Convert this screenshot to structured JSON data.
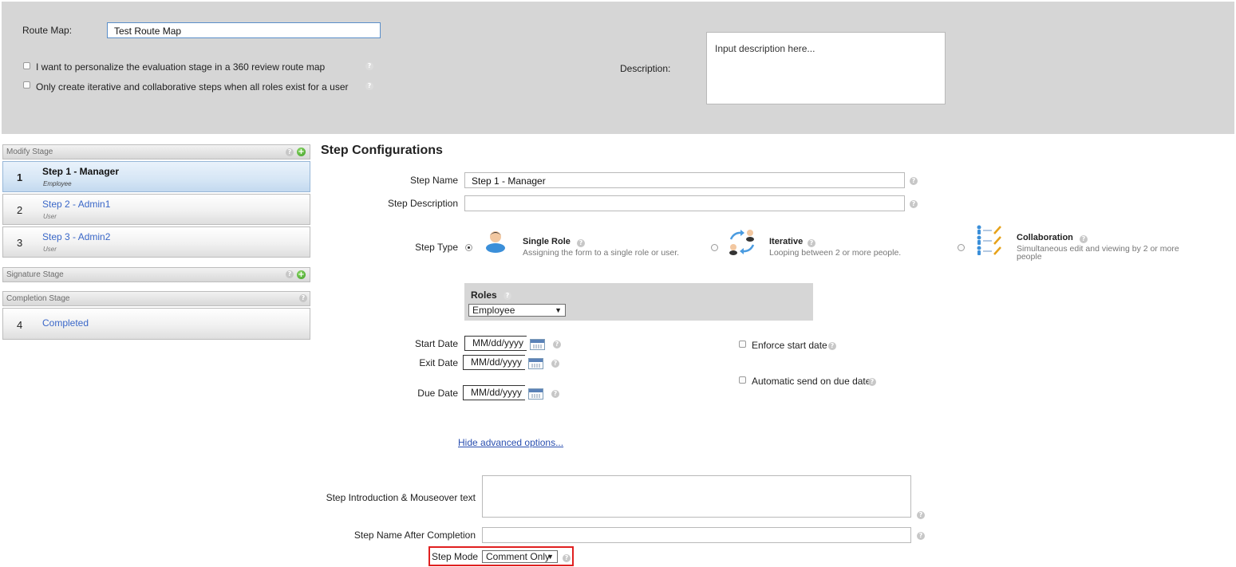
{
  "header": {
    "route_map_label": "Route Map:",
    "route_map_value": "Test Route Map",
    "personalize_label": "I want to personalize the evaluation stage in a 360 review route map",
    "iterative_label": "Only create iterative and collaborative steps when all roles exist for a user",
    "description_label": "Description:",
    "description_placeholder": "Input description here..."
  },
  "stages": {
    "modify_stage": "Modify Stage",
    "signature_stage": "Signature Stage",
    "completion_stage": "Completion Stage",
    "steps": [
      {
        "num": "1",
        "name": "Step 1 - Manager",
        "role": "Employee"
      },
      {
        "num": "2",
        "name": "Step 2 - Admin1",
        "role": "User"
      },
      {
        "num": "3",
        "name": "Step 3 - Admin2",
        "role": "User"
      }
    ],
    "completed": {
      "num": "4",
      "name": "Completed"
    }
  },
  "config": {
    "title": "Step Configurations",
    "step_name_label": "Step Name",
    "step_name_value": "Step 1 - Manager",
    "step_description_label": "Step Description",
    "step_description_value": "",
    "step_type_label": "Step Type",
    "types": [
      {
        "title": "Single Role",
        "desc": "Assigning the form to a single role or user.",
        "icon": "single-role-person-icon"
      },
      {
        "title": "Iterative",
        "desc": "Looping between 2 or more people.",
        "icon": "iterative-arrows-icon"
      },
      {
        "title": "Collaboration",
        "desc": "Simultaneous edit and viewing by 2 or more people",
        "icon": "collaboration-people-icon"
      }
    ],
    "selected_type": "Single Role",
    "roles_label": "Roles",
    "roles_value": "Employee",
    "start_date_label": "Start Date",
    "exit_date_label": "Exit Date",
    "due_date_label": "Due Date",
    "date_placeholder": "MM/dd/yyyy",
    "enforce_start_label": "Enforce start date",
    "auto_send_label": "Automatic send on due date",
    "hide_advanced_link": "Hide advanced options...",
    "intro_label": "Step Introduction & Mouseover text",
    "name_after_label": "Step Name After Completion",
    "step_mode_label": "Step Mode",
    "step_mode_value": "Comment Only"
  },
  "colors": {
    "header_bg": "#d6d6d6",
    "link": "#3a67c8",
    "selected_step_bg": "#d6e6f5",
    "highlight_box": "#e02020",
    "add_green": "#3a9a22"
  }
}
